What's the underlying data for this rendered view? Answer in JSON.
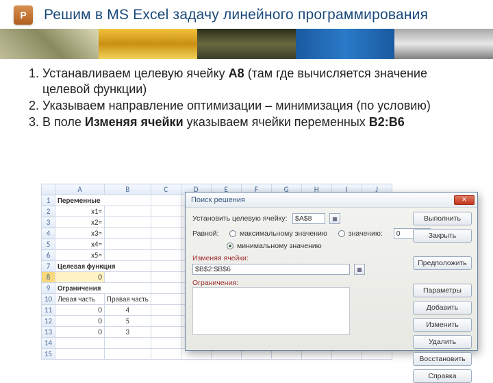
{
  "header": {
    "logo_letter": "P",
    "title": "Решим в MS Excel задачу линейного программирования"
  },
  "steps": [
    {
      "pre": "Устанавливаем целевую ячейку ",
      "bold": "A8",
      "post": " (там где вычисляется значение целевой функции)"
    },
    {
      "pre": "Указываем направление оптимизации – минимизация (по условию)",
      "bold": "",
      "post": ""
    },
    {
      "pre": "В поле ",
      "bold": "Изменяя ячейки",
      "post": " указываем ячейки переменных ",
      "bold2": "B2:B6"
    }
  ],
  "sheet": {
    "cols": [
      "",
      "A",
      "B",
      "C",
      "D",
      "E",
      "F",
      "G",
      "H",
      "I",
      "J"
    ],
    "rows": [
      {
        "n": 1,
        "A": "Переменные",
        "bold": true
      },
      {
        "n": 2,
        "A": "x1="
      },
      {
        "n": 3,
        "A": "x2="
      },
      {
        "n": 4,
        "A": "x3="
      },
      {
        "n": 5,
        "A": "x4="
      },
      {
        "n": 6,
        "A": "x5="
      },
      {
        "n": 7,
        "A": "Целевая функция",
        "bold": true
      },
      {
        "n": 8,
        "A": "0",
        "sel": true
      },
      {
        "n": 9,
        "A": "Ограничения",
        "bold": true
      },
      {
        "n": 10,
        "A": "Левая часть",
        "B": "Правая часть",
        "header": true
      },
      {
        "n": 11,
        "A": "0",
        "B": "4"
      },
      {
        "n": 12,
        "A": "0",
        "B": "5"
      },
      {
        "n": 13,
        "A": "0",
        "B": "3"
      },
      {
        "n": 14,
        "A": ""
      },
      {
        "n": 15,
        "A": ""
      }
    ]
  },
  "dialog": {
    "title": "Поиск решения",
    "target_label": "Установить целевую ячейку:",
    "target_value": "$A$8",
    "equal_label": "Равной:",
    "opt_max": "максимальному значению",
    "opt_val": "значению:",
    "opt_val_value": "0",
    "opt_min": "минимальному значению",
    "changing_label": "Изменяя ячейки:",
    "changing_value": "$B$2:$B$6",
    "constraints_label": "Ограничения:",
    "buttons": {
      "run": "Выполнить",
      "close": "Закрыть",
      "guess": "Предположить",
      "params": "Параметры",
      "add": "Добавить",
      "edit": "Изменить",
      "delete": "Удалить",
      "restore": "Восстановить",
      "help": "Справка"
    }
  }
}
